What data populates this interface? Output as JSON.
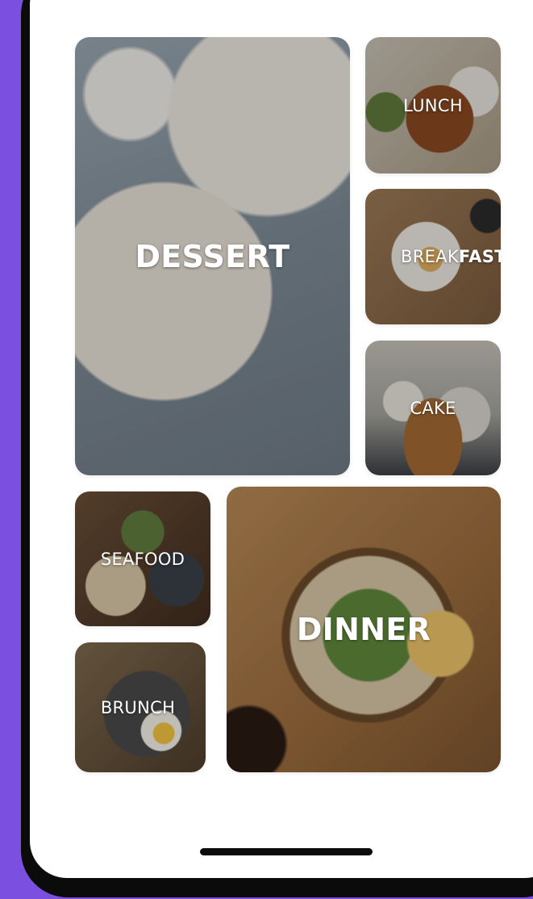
{
  "theme": {
    "background": "#7b4fe0",
    "frame": "#0b0b0b",
    "screen": "#ffffff",
    "label_color": "#ffffff"
  },
  "categories": {
    "dessert": {
      "label": "DESSERT"
    },
    "lunch": {
      "label": "LUNCH"
    },
    "breakfast": {
      "label_regular": "BREAK",
      "label_bold": "FAST"
    },
    "cake": {
      "label": "CAKE"
    },
    "seafood": {
      "label": "SEAFOOD"
    },
    "brunch": {
      "label": "BRUNCH"
    },
    "dinner": {
      "label": "DINNER"
    }
  }
}
